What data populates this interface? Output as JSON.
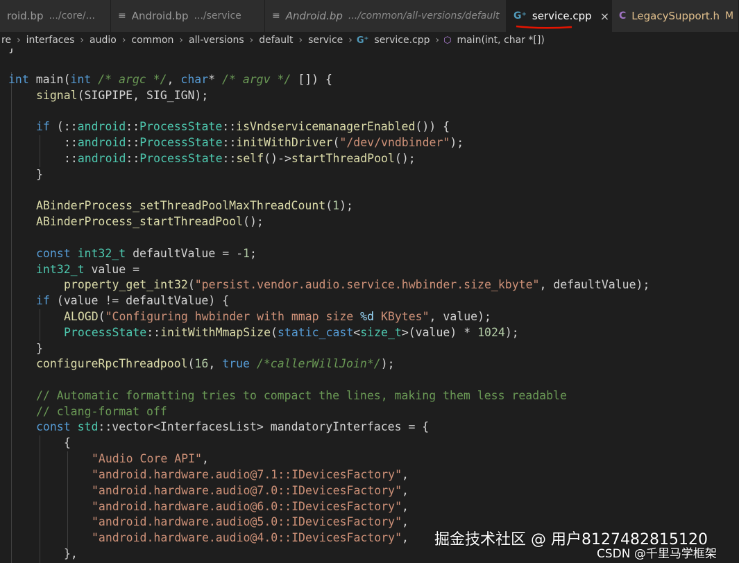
{
  "tabs": [
    {
      "label": "roid.bp",
      "desc": ".../core/...",
      "active": false
    },
    {
      "label": "Android.bp",
      "desc": ".../service",
      "active": false
    },
    {
      "label": "Android.bp",
      "desc": ".../common/all-versions/default",
      "active": false
    },
    {
      "label": "service.cpp",
      "close": "×",
      "active": true
    },
    {
      "label": "LegacySupport.h",
      "modified": "M",
      "active": false
    }
  ],
  "breadcrumb": {
    "items": [
      "re",
      "interfaces",
      "audio",
      "common",
      "all-versions",
      "default",
      "service"
    ],
    "file": "service.cpp",
    "symbol": "main(int, char *[])"
  },
  "code": {
    "l0": "}",
    "l2": [
      "int",
      " main(",
      "int",
      " ",
      "/* argc */",
      ", ",
      "char",
      "* ",
      "/* argv */",
      " []) {"
    ],
    "l3": [
      "signal",
      "(SIGPIPE, SIG_IGN);"
    ],
    "l5": [
      "if",
      " (::",
      "android",
      "::",
      "ProcessState",
      "::",
      "isVndservicemanagerEnabled",
      "()) {"
    ],
    "l6": [
      "::",
      "android",
      "::",
      "ProcessState",
      "::",
      "initWithDriver",
      "(",
      "\"/dev/vndbinder\"",
      ");"
    ],
    "l7": [
      "::",
      "android",
      "::",
      "ProcessState",
      "::",
      "self",
      "()->",
      "startThreadPool",
      "();"
    ],
    "l8": "}",
    "l10": [
      "ABinderProcess_setThreadPoolMaxThreadCount",
      "(",
      "1",
      ");"
    ],
    "l11": [
      "ABinderProcess_startThreadPool",
      "();"
    ],
    "l13": [
      "const",
      " ",
      "int32_t",
      " defaultValue = -",
      "1",
      ";"
    ],
    "l14": [
      "int32_t",
      " value ="
    ],
    "l15": [
      "property_get_int32",
      "(",
      "\"persist.vendor.audio.service.hwbinder.size_kbyte\"",
      ", defaultValue);"
    ],
    "l16": [
      "if",
      " (value != defaultValue) {"
    ],
    "l17": [
      "ALOGD",
      "(",
      "\"Configuring hwbinder with mmap size ",
      "%d",
      " KBytes\"",
      ", value);"
    ],
    "l18": [
      "ProcessState",
      "::",
      "initWithMmapSize",
      "(",
      "static_cast",
      "<",
      "size_t",
      ">(value) * ",
      "1024",
      ");"
    ],
    "l19": "}",
    "l20": [
      "configureRpcThreadpool",
      "(",
      "16",
      ", ",
      "true",
      " ",
      "/*callerWillJoin*/",
      ");"
    ],
    "l22": "// Automatic formatting tries to compact the lines, making them less readable",
    "l23": "// clang-format off",
    "l24": [
      "const",
      " ",
      "std",
      "::vector<InterfacesList> mandatoryInterfaces = {"
    ],
    "l25": "{",
    "l26": [
      "\"Audio Core API\"",
      ","
    ],
    "l27": [
      "\"android.hardware.audio@7.1::IDevicesFactory\"",
      ","
    ],
    "l28": [
      "\"android.hardware.audio@7.0::IDevicesFactory\"",
      ","
    ],
    "l29": [
      "\"android.hardware.audio@6.0::IDevicesFactory\"",
      ","
    ],
    "l30": [
      "\"android.hardware.audio@5.0::IDevicesFactory\"",
      ","
    ],
    "l31": [
      "\"android.hardware.audio@4.0::IDevicesFactory\"",
      ","
    ],
    "l32": "},"
  },
  "watermark": {
    "line1": "掘金技术社区 @ 用户8127482815120",
    "line2": "CSDN @千里马学框架"
  },
  "colors": {
    "accent_underline": "#e51400",
    "cpp_icon": "#519aba",
    "header_icon": "#a074c4"
  }
}
